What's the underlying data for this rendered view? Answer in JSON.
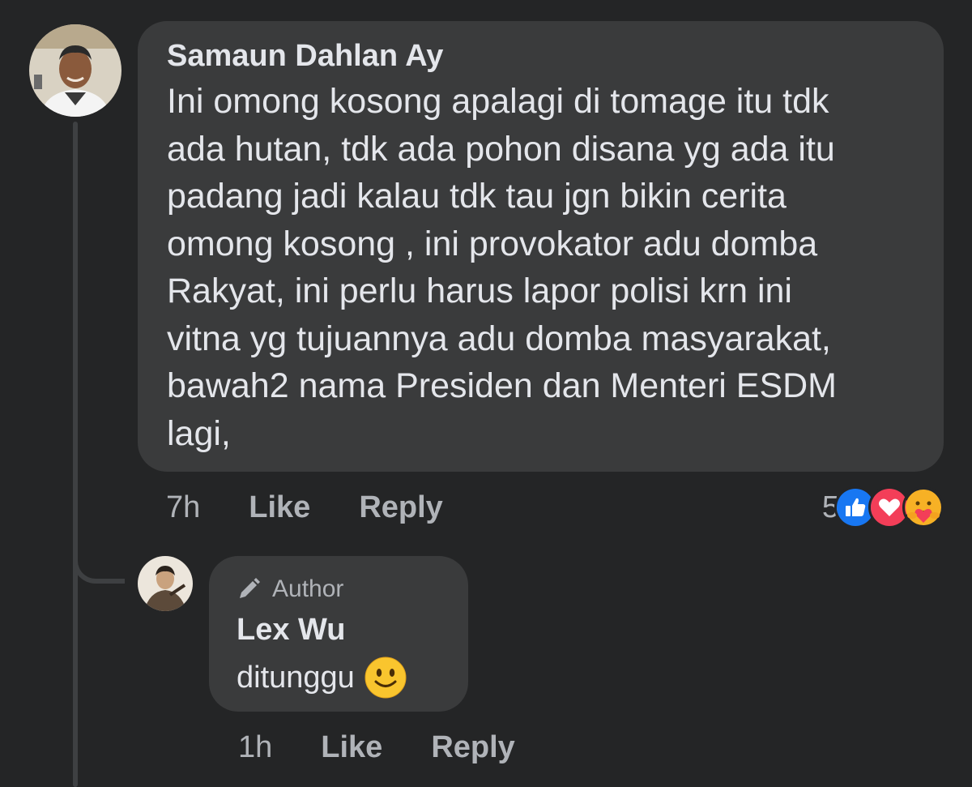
{
  "main_comment": {
    "author": "Samaun Dahlan Ay",
    "text": "Ini omong kosong apalagi di tomage itu tdk\nada hutan, tdk ada pohon disana yg ada itu\npadang jadi kalau tdk tau jgn bikin cerita\nomong kosong , ini provokator adu domba\nRakyat, ini perlu harus lapor polisi krn ini\nvitna yg tujuannya adu domba masyarakat,\nbawah2 nama Presiden dan Menteri ESDM\nlagi,",
    "time": "7h",
    "like_label": "Like",
    "reply_label": "Reply",
    "reaction_count": "5",
    "reactions": [
      "like-icon",
      "love-icon",
      "care-icon"
    ]
  },
  "reply_comment": {
    "badge": "Author",
    "badge_icon": "pencil-icon",
    "author": "Lex Wu",
    "text": "ditunggu",
    "emoji": "smile-emoji-icon",
    "time": "1h",
    "like_label": "Like",
    "reply_label": "Reply"
  },
  "colors": {
    "background": "#242526",
    "bubble": "#3a3b3c",
    "text_primary": "#e4e6eb",
    "text_secondary": "#b0b3b8",
    "like_blue": "#1877f2",
    "love_red": "#f33e58",
    "care_yellow": "#f7b125"
  }
}
